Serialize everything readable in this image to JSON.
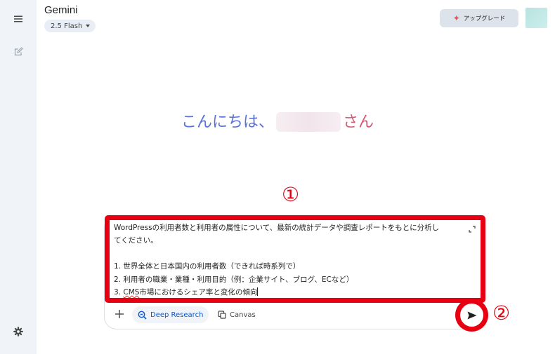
{
  "app": {
    "title": "Gemini"
  },
  "model": {
    "label": "2.5 Flash"
  },
  "header": {
    "upgrade_label": "アップグレード"
  },
  "greeting": {
    "prefix": "こんにちは、",
    "suffix": "さん"
  },
  "annotations": {
    "step1": "①",
    "step2": "②"
  },
  "composer": {
    "prompt_lines": [
      "WordPressの利用者数と利用者の属性について、最新の統計データや調査レポートをもとに分析し",
      "てください。",
      "",
      "1. 世界全体と日本国内の利用者数（できれば時系列で）",
      "2. 利用者の職業・業種・利用目的（例：企業サイト、ブログ、ECなど）"
    ],
    "line5": {
      "prefix": "3. ",
      "misspelled": "CMS",
      "rest": "市場におけるシェア率と変化の傾向"
    },
    "tools": {
      "deep_research_label": "Deep Research",
      "canvas_label": "Canvas"
    }
  },
  "icons": {
    "menu": "menu-icon",
    "new_chat": "edit-icon",
    "settings": "gear-icon",
    "upgrade": "sparkle-icon",
    "add": "plus-icon",
    "deep_research": "deep-research-icon",
    "canvas": "canvas-icon",
    "send": "send-icon",
    "expand": "expand-icon"
  },
  "colors": {
    "sidebar_bg": "#f0f4f9",
    "greeting_blue": "#5b73d9",
    "greeting_pink": "#cf5f76",
    "accent_blue": "#0b57d0",
    "highlight_red": "#e60012"
  }
}
